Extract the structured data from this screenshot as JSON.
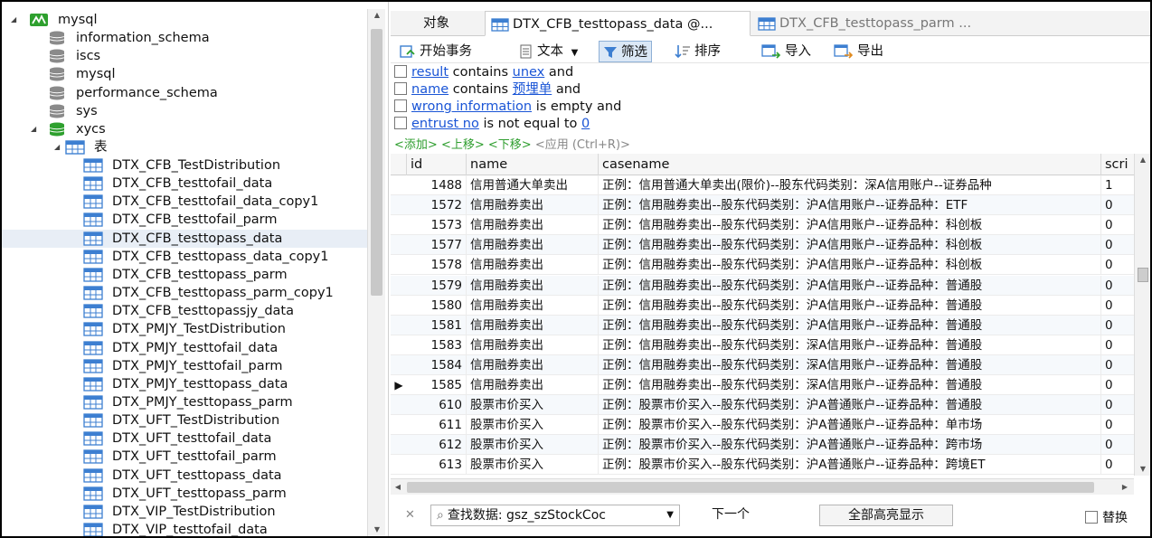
{
  "tree": {
    "connection": "mysql",
    "databases": [
      "information_schema",
      "iscs",
      "mysql",
      "performance_schema",
      "sys",
      "xycs"
    ],
    "tables_folder": "表",
    "tables": [
      "DTX_CFB_TestDistribution",
      "DTX_CFB_testtofail_data",
      "DTX_CFB_testtofail_data_copy1",
      "DTX_CFB_testtofail_parm",
      "DTX_CFB_testtopass_data",
      "DTX_CFB_testtopass_data_copy1",
      "DTX_CFB_testtopass_parm",
      "DTX_CFB_testtopass_parm_copy1",
      "DTX_CFB_testtopassjy_data",
      "DTX_PMJY_TestDistribution",
      "DTX_PMJY_testtofail_data",
      "DTX_PMJY_testtofail_parm",
      "DTX_PMJY_testtopass_data",
      "DTX_PMJY_testtopass_parm",
      "DTX_UFT_TestDistribution",
      "DTX_UFT_testtofail_data",
      "DTX_UFT_testtofail_parm",
      "DTX_UFT_testtopass_data",
      "DTX_UFT_testtopass_parm",
      "DTX_VIP_TestDistribution",
      "DTX_VIP_testtofail_data"
    ],
    "selected_table": "DTX_CFB_testtopass_data"
  },
  "tabs": {
    "objects": "对象",
    "tab1": "DTX_CFB_testtopass_data @...",
    "tab2": "DTX_CFB_testtopass_parm ..."
  },
  "toolbar": {
    "begin_tx": "开始事务",
    "text": "文本",
    "filter": "筛选",
    "sort": "排序",
    "import": "导入",
    "export": "导出"
  },
  "filters": [
    {
      "field": "result",
      "op": "contains",
      "value": "unex",
      "conj": "and"
    },
    {
      "field": "name",
      "op": "contains",
      "value": "预埋单",
      "conj": "and"
    },
    {
      "field": "wrong information",
      "op": "is empty and",
      "value": "",
      "conj": ""
    },
    {
      "field": "entrust no",
      "op": "is not equal to",
      "value": "0",
      "conj": ""
    }
  ],
  "filter_actions": {
    "add": "<添加>",
    "up": "<上移>",
    "down": "<下移>",
    "apply": "<应用 (Ctrl+R)>"
  },
  "grid": {
    "columns": [
      "id",
      "name",
      "casename",
      "scri"
    ],
    "rows": [
      {
        "id": "1488",
        "name": "信用普通大单卖出",
        "casename": "正例：信用普通大单卖出(限价)--股东代码类别：深A信用账户--证券品种",
        "scri": "1"
      },
      {
        "id": "1572",
        "name": "信用融券卖出",
        "casename": "正例：信用融券卖出--股东代码类别：沪A信用账户--证券品种：ETF",
        "scri": "0"
      },
      {
        "id": "1573",
        "name": "信用融券卖出",
        "casename": "正例：信用融券卖出--股东代码类别：沪A信用账户--证券品种：科创板",
        "scri": "0"
      },
      {
        "id": "1577",
        "name": "信用融券卖出",
        "casename": "正例：信用融券卖出--股东代码类别：沪A信用账户--证券品种：科创板",
        "scri": "0"
      },
      {
        "id": "1578",
        "name": "信用融券卖出",
        "casename": "正例：信用融券卖出--股东代码类别：沪A信用账户--证券品种：科创板",
        "scri": "0"
      },
      {
        "id": "1579",
        "name": "信用融券卖出",
        "casename": "正例：信用融券卖出--股东代码类别：沪A信用账户--证券品种：普通股",
        "scri": "0"
      },
      {
        "id": "1580",
        "name": "信用融券卖出",
        "casename": "正例：信用融券卖出--股东代码类别：沪A信用账户--证券品种：普通股",
        "scri": "0"
      },
      {
        "id": "1581",
        "name": "信用融券卖出",
        "casename": "正例：信用融券卖出--股东代码类别：沪A信用账户--证券品种：普通股",
        "scri": "0"
      },
      {
        "id": "1583",
        "name": "信用融券卖出",
        "casename": "正例：信用融券卖出--股东代码类别：深A信用账户--证券品种：普通股",
        "scri": "0"
      },
      {
        "id": "1584",
        "name": "信用融券卖出",
        "casename": "正例：信用融券卖出--股东代码类别：深A信用账户--证券品种：普通股",
        "scri": "0"
      },
      {
        "id": "1585",
        "name": "信用融券卖出",
        "casename": "正例：信用融券卖出--股东代码类别：深A信用账户--证券品种：普通股",
        "scri": "0"
      },
      {
        "id": "610",
        "name": "股票市价买入",
        "casename": "正例：股票市价买入--股东代码类别：沪A普通账户--证券品种：普通股",
        "scri": "0"
      },
      {
        "id": "611",
        "name": "股票市价买入",
        "casename": "正例：股票市价买入--股东代码类别：沪A普通账户--证券品种：单市场",
        "scri": "0"
      },
      {
        "id": "612",
        "name": "股票市价买入",
        "casename": "正例：股票市价买入--股东代码类别：沪A普通账户--证券品种：跨市场",
        "scri": "0"
      },
      {
        "id": "613",
        "name": "股票市价买入",
        "casename": "正例：股票市价买入--股东代码类别：沪A普通账户--证券品种：跨境ET",
        "scri": "0"
      }
    ],
    "current_row": "1585"
  },
  "findbar": {
    "search_text": "查找数据: gsz_szStockCoc",
    "next": "下一个",
    "highlight_all": "全部高亮显示",
    "replace": "替换"
  },
  "colors": {
    "link": "#1a55d6",
    "action_green": "#2f9e2f",
    "selection": "#e8eef6",
    "table_icon": "#3d7fd1",
    "db_green": "#2ea02e"
  }
}
